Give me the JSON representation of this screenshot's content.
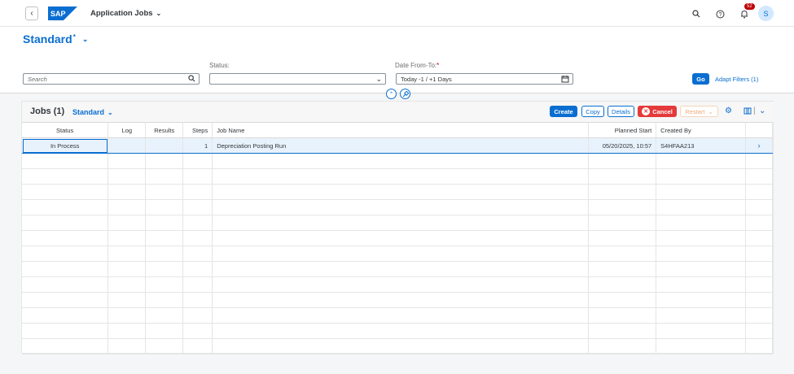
{
  "shell": {
    "app_title": "Application Jobs",
    "notification_count": "52",
    "user_initial": "S",
    "brand_color": "#0a6ed1"
  },
  "filterbar": {
    "variant_name": "Standard",
    "variant_modified": "*",
    "search_placeholder": "Search",
    "status_label": "Status:",
    "status_value": "",
    "date_label": "Date From-To:",
    "date_required": "*",
    "date_value": "Today -1 / +1 Days",
    "go_label": "Go",
    "adapt_filters_label": "Adapt Filters (1)"
  },
  "table": {
    "title": "Jobs (1)",
    "variant": "Standard",
    "buttons": {
      "create": "Create",
      "copy": "Copy",
      "details": "Details",
      "cancel": "Cancel",
      "restart": "Restart"
    },
    "columns": [
      "Status",
      "Log",
      "Results",
      "Steps",
      "Job Name",
      "Planned Start",
      "Created By"
    ],
    "rows": [
      {
        "status": "In Process",
        "log": "",
        "results": "",
        "steps": "1",
        "job_name": "Depreciation Posting Run",
        "planned_start": "05/20/2025, 10:57",
        "created_by": "S4HFAA213"
      }
    ]
  }
}
